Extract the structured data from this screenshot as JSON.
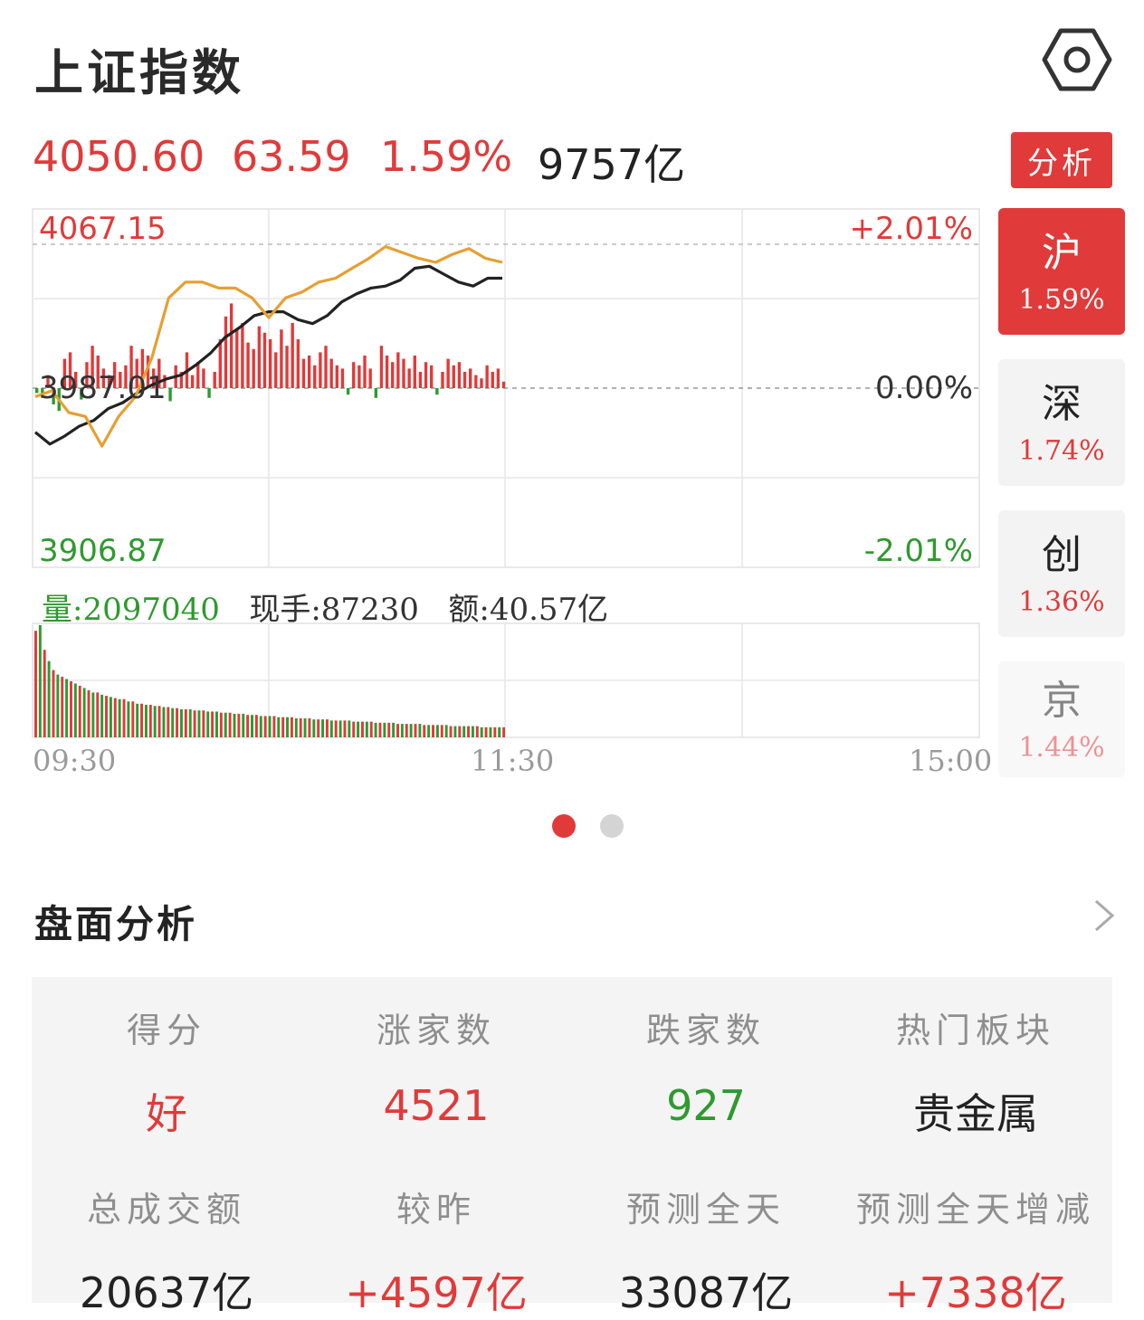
{
  "header": {
    "title": "上证指数",
    "settings_icon": "settings-hexagon-icon"
  },
  "quote": {
    "price": "4050.60",
    "change": "63.59",
    "change_pct": "1.59%",
    "turnover": "9757亿",
    "analysis_button": "分析"
  },
  "chart_labels": {
    "top_price": "4067.15",
    "mid_price": "3987.01",
    "bottom_price": "3906.87",
    "top_pct": "+2.01%",
    "mid_pct": "0.00%",
    "bottom_pct": "-2.01%"
  },
  "volume_info": {
    "vol_label": "量",
    "vol_value": ":2097040",
    "hand_label": "现手",
    "hand_value": ":87230",
    "amt_label": "额",
    "amt_value": ":40.57亿"
  },
  "time_axis": {
    "start": "09:30",
    "mid": "11:30",
    "end": "15:00"
  },
  "market_tabs": [
    {
      "name": "沪",
      "pct": "1.59%",
      "active": true
    },
    {
      "name": "深",
      "pct": "1.74%",
      "active": false
    },
    {
      "name": "创",
      "pct": "1.36%",
      "active": false
    },
    {
      "name": "京",
      "pct": "1.44%",
      "active": false
    }
  ],
  "pager": {
    "pages": 2,
    "current": 1
  },
  "analysis_section": {
    "title": "盘面分析",
    "row1": [
      {
        "label": "得分",
        "value": "好",
        "color": "red"
      },
      {
        "label": "涨家数",
        "value": "4521",
        "color": "red"
      },
      {
        "label": "跌家数",
        "value": "927",
        "color": "green"
      },
      {
        "label": "热门板块",
        "value": "贵金属",
        "color": "dark"
      }
    ],
    "row2": [
      {
        "label": "总成交额",
        "value": "20637亿",
        "color": "dark"
      },
      {
        "label": "较昨",
        "value": "+4597亿",
        "color": "red"
      },
      {
        "label": "预测全天",
        "value": "33087亿",
        "color": "dark"
      },
      {
        "label": "预测全天增减",
        "value": "+7338亿",
        "color": "red"
      }
    ]
  },
  "chart_data": {
    "type": "line",
    "x_range": [
      "09:30",
      "15:00"
    ],
    "ylim": [
      3906.87,
      4067.15
    ],
    "baseline": 3987.01,
    "series": [
      {
        "color": "#222222",
        "values": [
          3972,
          3966,
          3970,
          3975,
          3978,
          3984,
          3987,
          3992,
          3996,
          3999,
          4001,
          4006,
          4012,
          4020,
          4025,
          4031,
          4033,
          4033,
          4029,
          4027,
          4031,
          4038,
          4042,
          4045,
          4046,
          4049,
          4055,
          4056,
          4052,
          4048,
          4046,
          4050,
          4050
        ]
      },
      {
        "color": "#e5a032",
        "values": [
          3990,
          3993,
          3982,
          3980,
          3965,
          3980,
          3990,
          4010,
          4040,
          4048,
          4048,
          4045,
          4045,
          4040,
          4030,
          4040,
          4043,
          4048,
          4050,
          4055,
          4060,
          4066,
          4063,
          4060,
          4058,
          4062,
          4065,
          4060,
          4058
        ]
      }
    ],
    "tick_bars": [
      -3,
      -6,
      8,
      -10,
      -14,
      18,
      22,
      10,
      -7,
      16,
      26,
      20,
      12,
      8,
      16,
      10,
      14,
      26,
      18,
      24,
      20,
      12,
      18,
      8,
      -8,
      14,
      10,
      22,
      8,
      16,
      12,
      -6,
      10,
      30,
      44,
      52,
      36,
      40,
      28,
      24,
      38,
      34,
      30,
      22,
      36,
      26,
      40,
      30,
      18,
      20,
      14,
      22,
      26,
      18,
      14,
      12,
      -4,
      16,
      14,
      20,
      12,
      -6,
      26,
      20,
      16,
      22,
      18,
      12,
      20,
      10,
      16,
      14,
      -4,
      10,
      18,
      14,
      16,
      10,
      12,
      8,
      6,
      14,
      10,
      12,
      4
    ],
    "volume_bars": [
      95,
      100,
      78,
      68,
      60,
      56,
      54,
      52,
      50,
      48,
      46,
      44,
      42,
      40,
      40,
      38,
      37,
      36,
      35,
      34,
      34,
      32,
      32,
      30,
      30,
      29,
      29,
      28,
      28,
      27,
      27,
      26,
      26,
      25,
      25,
      25,
      24,
      24,
      24,
      23,
      23,
      23,
      22,
      22,
      22,
      21,
      21,
      21,
      20,
      20,
      20,
      19,
      19,
      19,
      19,
      18,
      18,
      18,
      18,
      17,
      17,
      17,
      17,
      16,
      16,
      16,
      16,
      15,
      15,
      15,
      15,
      15,
      14,
      14,
      14,
      14,
      14,
      13,
      13,
      13,
      13,
      13,
      12,
      12,
      12,
      12,
      12,
      12,
      11,
      11,
      11,
      11,
      11,
      11,
      10,
      10,
      10,
      10,
      10,
      10,
      10,
      9,
      9,
      9,
      9,
      9,
      9
    ]
  }
}
